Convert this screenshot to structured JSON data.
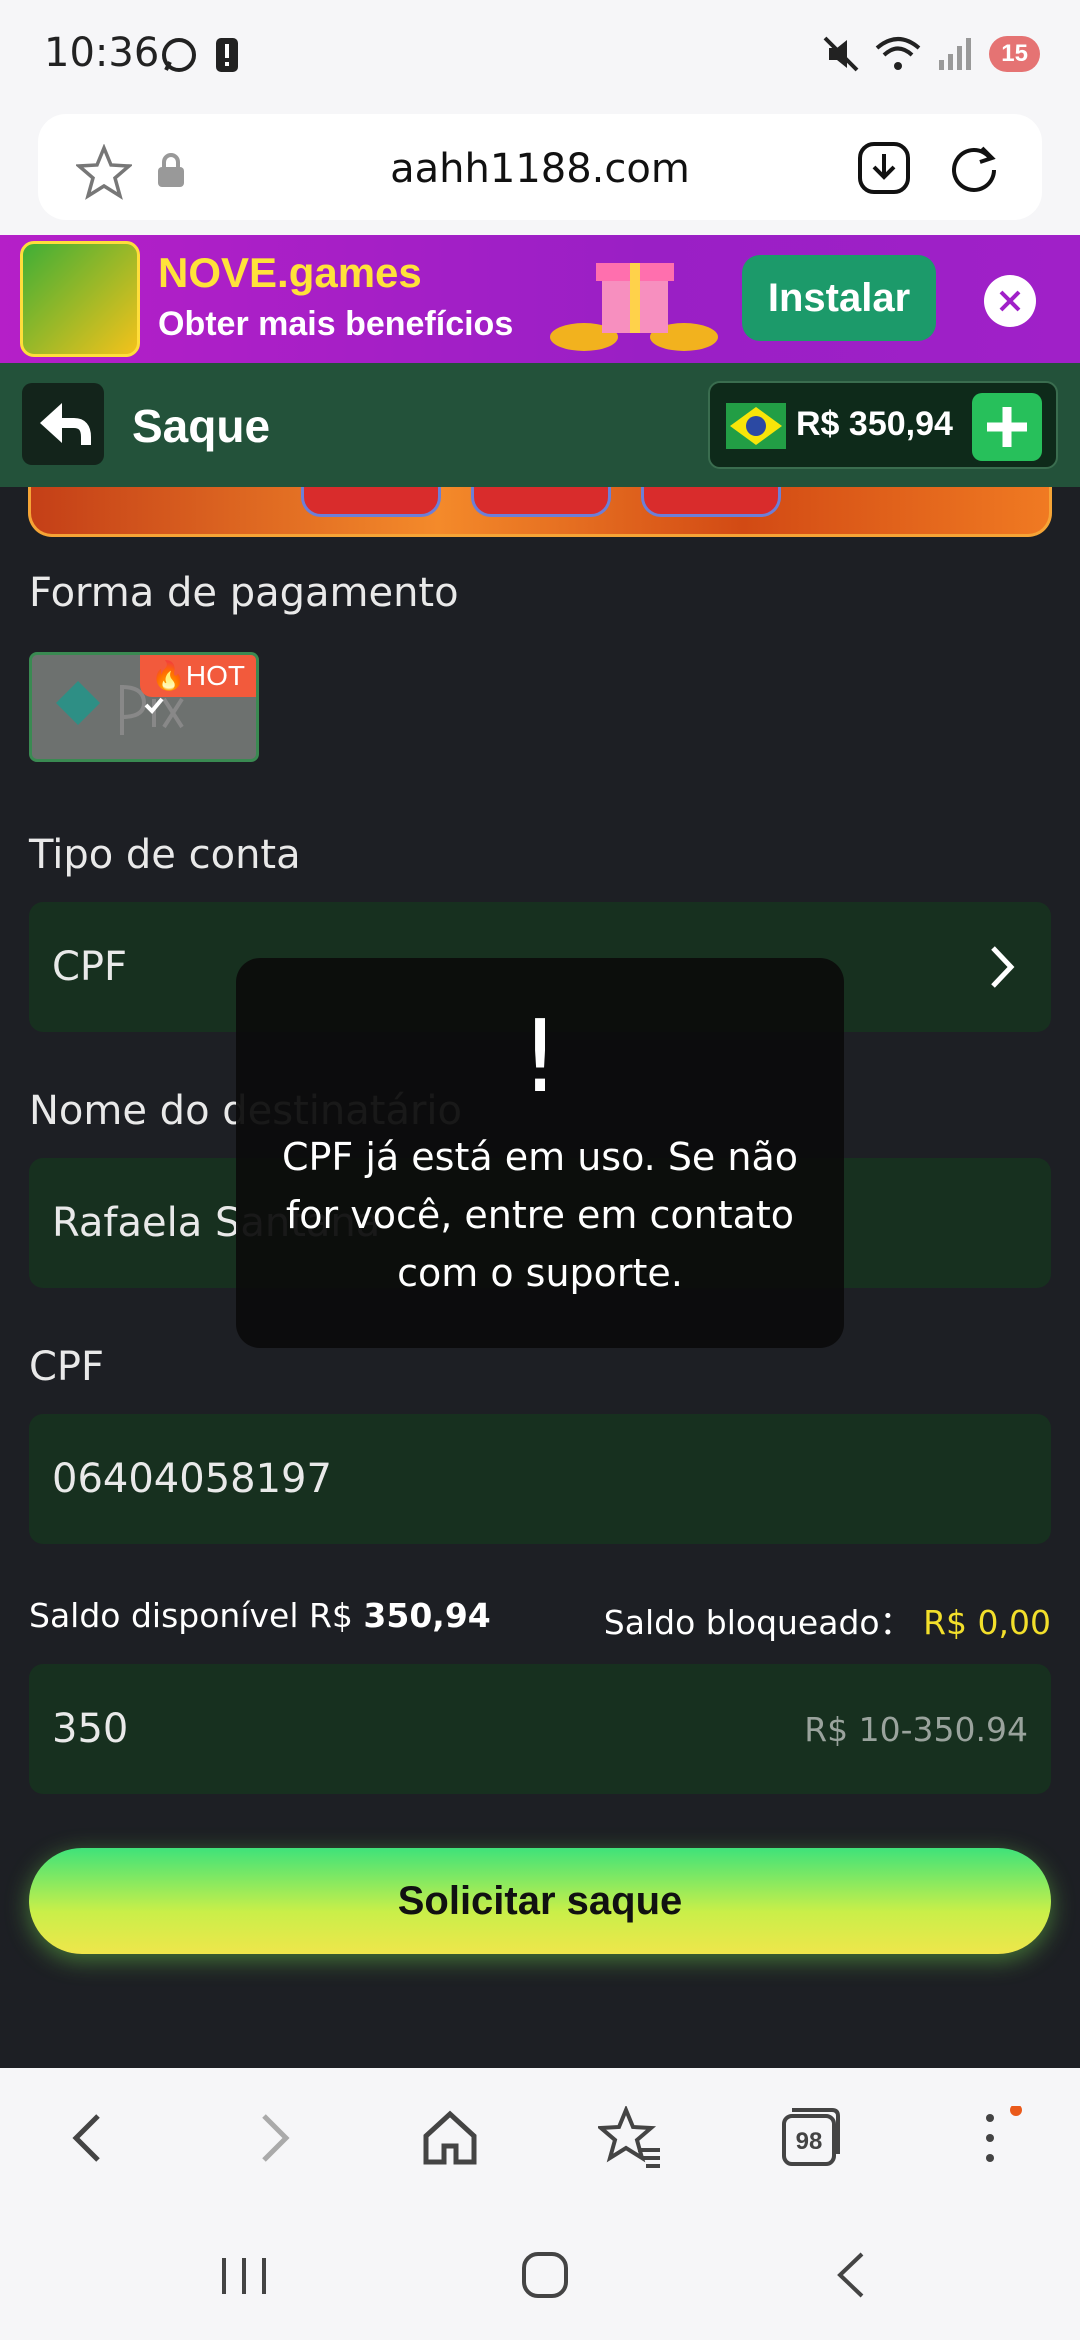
{
  "status_bar": {
    "time": "10:36",
    "battery": "15"
  },
  "browser": {
    "url": "aahh1188.com",
    "tab_count": "98"
  },
  "promo": {
    "title": "NOVE.games",
    "subtitle": "Obter mais benefícios",
    "install_label": "Instalar"
  },
  "header": {
    "title": "Saque",
    "balance": "R$ 350,94"
  },
  "form": {
    "payment_label": "Forma de pagamento",
    "hot_badge": "HOT",
    "account_type_label": "Tipo de conta",
    "account_type_value": "CPF",
    "recipient_label": "Nome do destinatário",
    "recipient_value": "Rafaela Santana",
    "cpf_label": "CPF",
    "cpf_value": "06404058197",
    "available_label": "Saldo disponível R$",
    "available_value": "350,94",
    "blocked_label": "Saldo bloqueado：",
    "blocked_value": "R$ 0,00",
    "amount_value": "350",
    "amount_range": "R$ 10-350.94",
    "submit_label": "Solicitar saque"
  },
  "toast": {
    "icon": "!",
    "message": "CPF já está em uso. Se não for você, entre em contato com o suporte."
  },
  "colors": {
    "accent_green": "#27c05b",
    "field_bg": "#17301f",
    "header_bg": "#23523a",
    "promo_purple": "#b51fc8",
    "blocked_yellow": "#f2df2b"
  }
}
